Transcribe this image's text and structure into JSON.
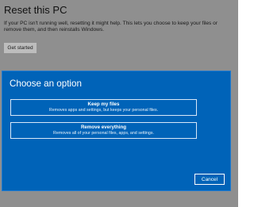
{
  "settings": {
    "title": "Reset this PC",
    "description": "If your PC isn't running well, resetting it might help. This lets you choose to keep your files or remove them, and then reinstalls Windows.",
    "get_started_label": "Get started"
  },
  "dialog": {
    "title": "Choose an option",
    "options": [
      {
        "title": "Keep my files",
        "description": "Removes apps and settings, but keeps your personal files."
      },
      {
        "title": "Remove everything",
        "description": "Removes all of your personal files, apps, and settings."
      }
    ],
    "cancel_label": "Cancel",
    "colors": {
      "background": "#0063b8",
      "overlay": "#8f8f8f"
    }
  }
}
